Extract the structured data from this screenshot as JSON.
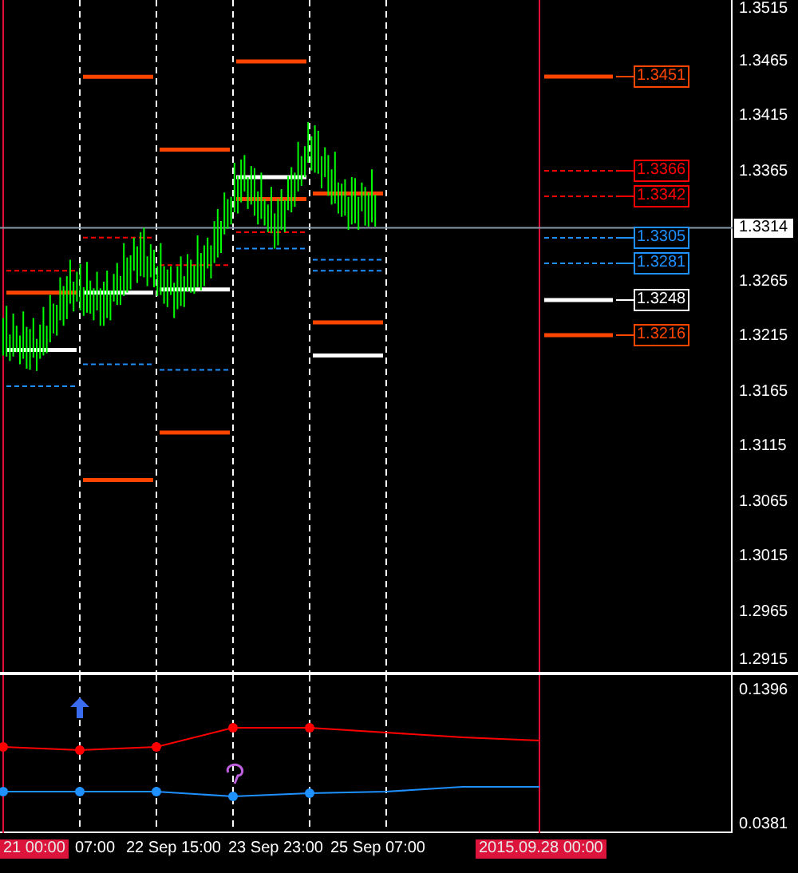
{
  "price_axis": {
    "ticks": [
      "1.3515",
      "1.3465",
      "1.3415",
      "1.3365",
      "1.3265",
      "1.3215",
      "1.3165",
      "1.3115",
      "1.3065",
      "1.3015",
      "1.2965",
      "1.2915"
    ],
    "current_price": "1.3314"
  },
  "levels": [
    {
      "price": "1.3451",
      "color": "#ff4500",
      "kind": "solid"
    },
    {
      "price": "1.3366",
      "color": "#ff0000",
      "kind": "dashed"
    },
    {
      "price": "1.3342",
      "color": "#ff0000",
      "kind": "dashed"
    },
    {
      "price": "1.3305",
      "color": "#1e90ff",
      "kind": "dashed"
    },
    {
      "price": "1.3281",
      "color": "#1e90ff",
      "kind": "dashed"
    },
    {
      "price": "1.3248",
      "color": "#ffffff",
      "kind": "solid"
    },
    {
      "price": "1.3216",
      "color": "#ff4500",
      "kind": "solid"
    }
  ],
  "indicator_axis": {
    "ticks": [
      "0.1396",
      "0.0381"
    ]
  },
  "time_axis": [
    {
      "label": "21 00:00",
      "kind": "marker"
    },
    {
      "label": "07:00",
      "kind": "tick"
    },
    {
      "label": "22 Sep 15:00",
      "kind": "tick"
    },
    {
      "label": "23 Sep 23:00",
      "kind": "tick"
    },
    {
      "label": "25 Sep 07:00",
      "kind": "tick"
    },
    {
      "label": "2015.09.28 00:00",
      "kind": "marker"
    }
  ]
}
